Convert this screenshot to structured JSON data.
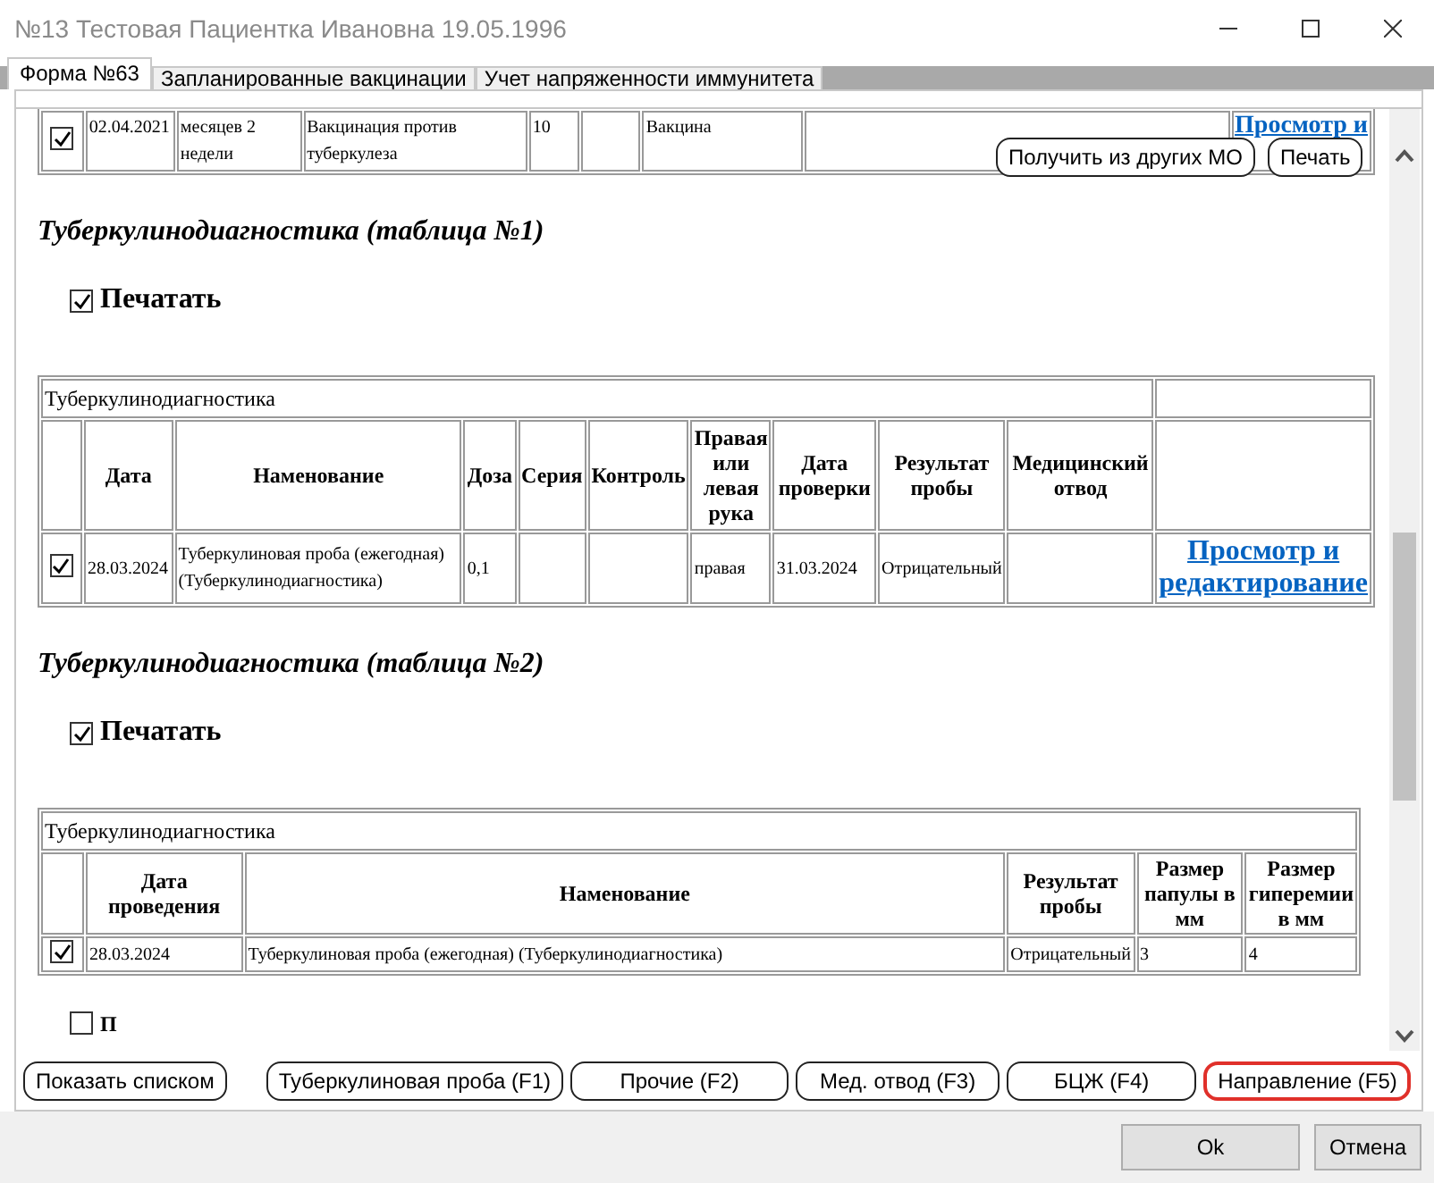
{
  "window": {
    "title": "№13 Тестовая Пациентка Ивановна 19.05.1996"
  },
  "tabs": [
    {
      "label": "Форма №63",
      "selected": true
    },
    {
      "label": "Запланированные вакцинации",
      "selected": false
    },
    {
      "label": "Учет напряженности иммунитета",
      "selected": false
    }
  ],
  "top_row": {
    "checked": true,
    "cells": [
      "02.04.2021",
      "месяцев 2 недели",
      "Вакцинация против туберкулеза",
      "10",
      "",
      "Вакцина",
      ""
    ],
    "link": "Просмотр и"
  },
  "overlay_buttons": [
    "Получить из других МО",
    "Печать"
  ],
  "sections": [
    {
      "heading": "Туберкулинодиагностика (таблица №1)",
      "print": {
        "label": "Печатать",
        "checked": true
      },
      "table": {
        "caption": "Туберкулинодиагностика",
        "columns": [
          "Дата",
          "Наменование",
          "Доза",
          "Серия",
          "Контроль",
          "Правая или левая рука",
          "Дата проверки",
          "Результат пробы",
          "Медицинский отвод"
        ],
        "rows": [
          {
            "checked": true,
            "cells": [
              "28.03.2024",
              "Туберкулиновая проба (ежегодная) (Туберкулинодиагностика)",
              "0,1",
              "",
              "",
              "правая",
              "31.03.2024",
              "Отрицательный",
              ""
            ],
            "link": "Просмотр и редактирование"
          }
        ]
      }
    },
    {
      "heading": "Туберкулинодиагностика (таблица №2)",
      "print": {
        "label": "Печатать",
        "checked": true
      },
      "table": {
        "caption": "Туберкулинодиагностика",
        "columns": [
          "Дата проведения",
          "Наменование",
          "Результат пробы",
          "Размер папулы в мм",
          "Размер гиперемии в мм"
        ],
        "rows": [
          {
            "checked": true,
            "cells": [
              "28.03.2024",
              "Туберкулиновая проба (ежегодная) (Туберкулинодиагностика)",
              "Отрицательный",
              "3",
              "4"
            ]
          }
        ]
      }
    }
  ],
  "partial_print": {
    "label": "П",
    "checked": false
  },
  "list_button": "Показать списком",
  "action_buttons": [
    {
      "label": "Туберкулиновая проба (F1)",
      "selected": false
    },
    {
      "label": "Прочие (F2)",
      "selected": false
    },
    {
      "label": "Мед. отвод (F3)",
      "selected": false
    },
    {
      "label": "БЦЖ (F4)",
      "selected": false
    },
    {
      "label": "Направление (F5)",
      "selected": true
    }
  ],
  "dialog_buttons": [
    "Ok",
    "Отмена"
  ]
}
